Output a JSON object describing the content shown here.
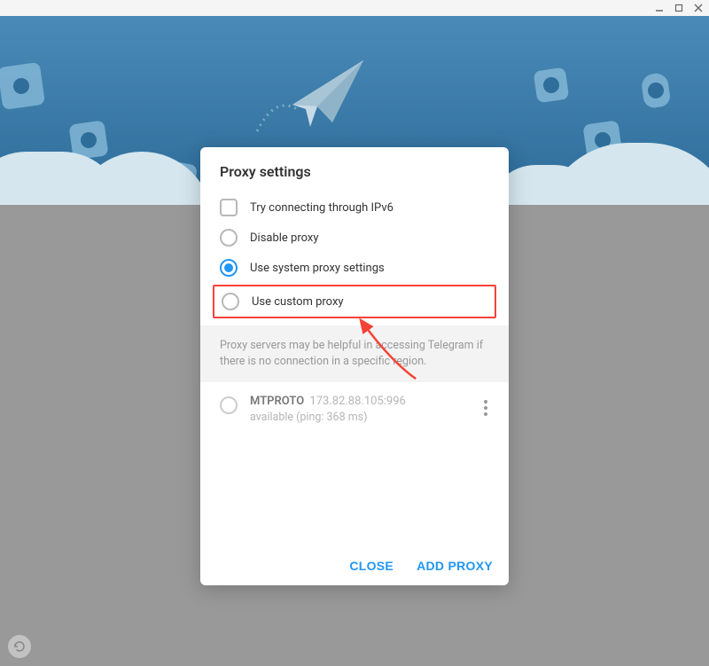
{
  "modal": {
    "title": "Proxy settings",
    "options": {
      "ipv6": "Try connecting through IPv6",
      "disable": "Disable proxy",
      "system": "Use system proxy settings",
      "custom": "Use custom proxy"
    },
    "info": "Proxy servers may be helpful in accessing Telegram if there is no connection in a specific region.",
    "proxy": {
      "name": "MTPROTO",
      "address": "173.82.88.105:996",
      "status": "available (ping: 368 ms)"
    },
    "buttons": {
      "close": "CLOSE",
      "add": "ADD PROXY"
    }
  }
}
